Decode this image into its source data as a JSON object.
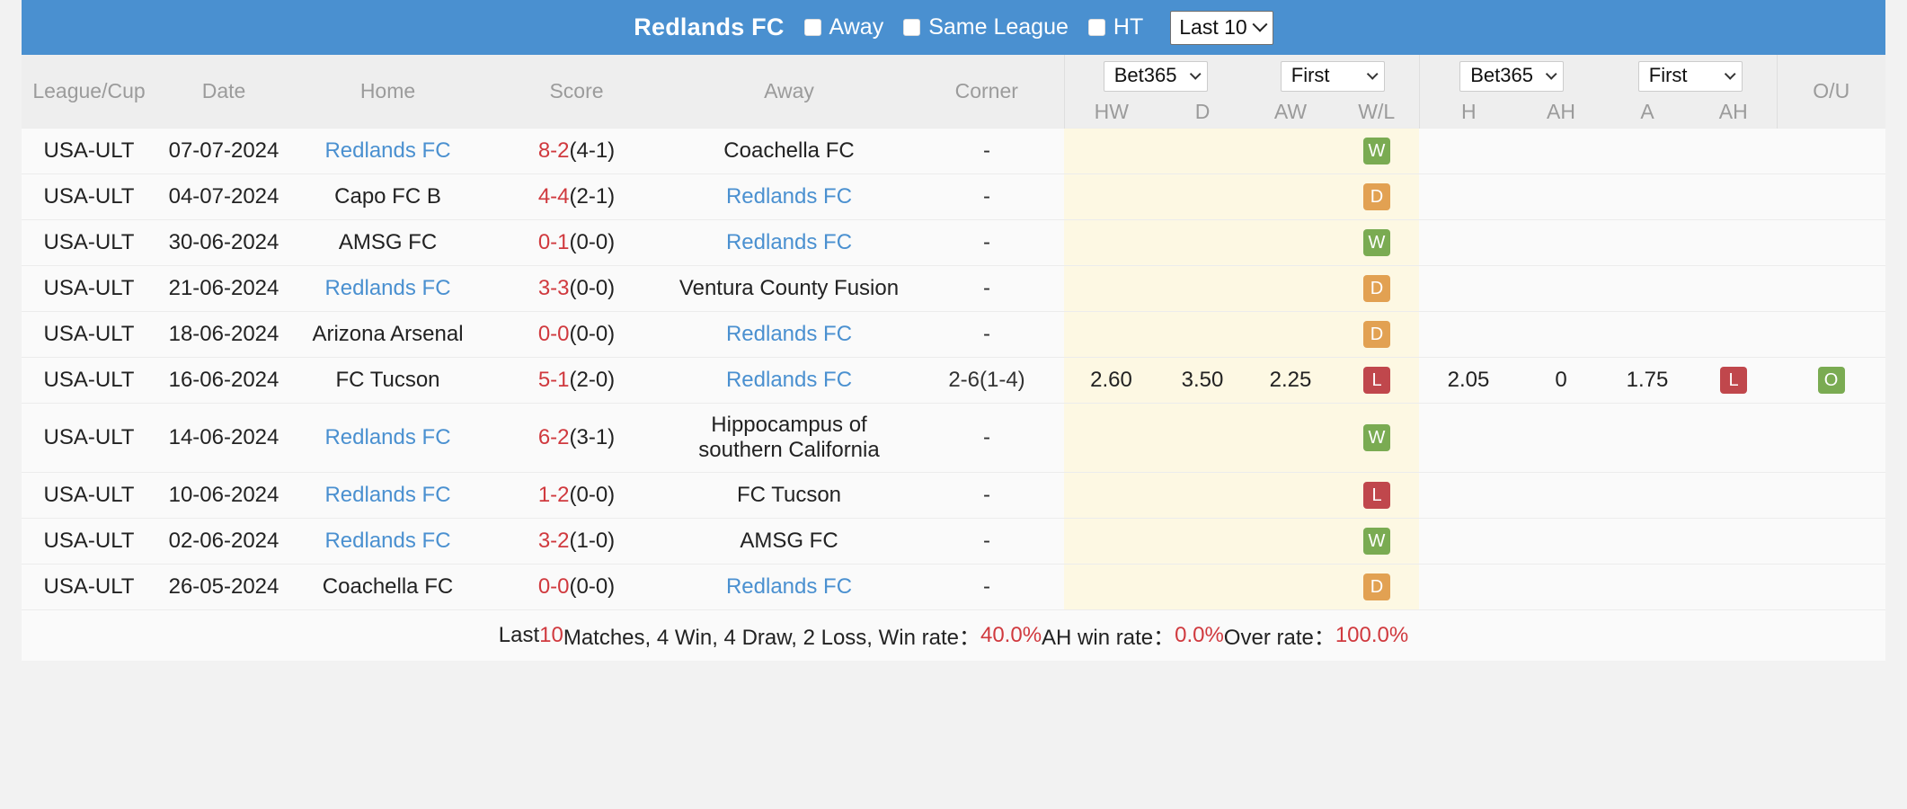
{
  "titlebar": {
    "team": "Redlands FC",
    "filters": [
      {
        "label": "Away",
        "checked": false
      },
      {
        "label": "Same League",
        "checked": false
      },
      {
        "label": "HT",
        "checked": false
      }
    ],
    "range_select": {
      "value": "Last 10",
      "icon": "chevron-down-icon"
    },
    "bg_color": "#4a90d0"
  },
  "table": {
    "headers": {
      "league": "League/Cup",
      "date": "Date",
      "home": "Home",
      "score": "Score",
      "away": "Away",
      "corner": "Corner",
      "ou": "O/U"
    },
    "group1": {
      "bookmaker": "Bet365",
      "period": "First",
      "subheaders": [
        "HW",
        "D",
        "AW",
        "W/L"
      ]
    },
    "group2": {
      "bookmaker": "Bet365",
      "period": "First",
      "subheaders": [
        "H",
        "AH",
        "A",
        "AH"
      ]
    },
    "rows": [
      {
        "league": "USA-ULT",
        "date": "07-07-2024",
        "home": "Redlands FC",
        "home_link": true,
        "score_main": "8-2",
        "score_ht": "(4-1)",
        "away": "Coachella FC",
        "away_link": false,
        "corner": "-",
        "hw": "",
        "d": "",
        "aw": "",
        "wl": "W",
        "wl_type": "w",
        "h": "",
        "ah1": "",
        "a": "",
        "ah2": "",
        "ah_res": "",
        "ah_res_type": "",
        "ou": "",
        "ou_type": ""
      },
      {
        "league": "USA-ULT",
        "date": "04-07-2024",
        "home": "Capo FC B",
        "home_link": false,
        "score_main": "4-4",
        "score_ht": "(2-1)",
        "away": "Redlands FC",
        "away_link": true,
        "corner": "-",
        "hw": "",
        "d": "",
        "aw": "",
        "wl": "D",
        "wl_type": "d",
        "h": "",
        "ah1": "",
        "a": "",
        "ah2": "",
        "ah_res": "",
        "ah_res_type": "",
        "ou": "",
        "ou_type": ""
      },
      {
        "league": "USA-ULT",
        "date": "30-06-2024",
        "home": "AMSG FC",
        "home_link": false,
        "score_main": "0-1",
        "score_ht": "(0-0)",
        "away": "Redlands FC",
        "away_link": true,
        "corner": "-",
        "hw": "",
        "d": "",
        "aw": "",
        "wl": "W",
        "wl_type": "w",
        "h": "",
        "ah1": "",
        "a": "",
        "ah2": "",
        "ah_res": "",
        "ah_res_type": "",
        "ou": "",
        "ou_type": ""
      },
      {
        "league": "USA-ULT",
        "date": "21-06-2024",
        "home": "Redlands FC",
        "home_link": true,
        "score_main": "3-3",
        "score_ht": "(0-0)",
        "away": "Ventura County Fusion",
        "away_link": false,
        "corner": "-",
        "hw": "",
        "d": "",
        "aw": "",
        "wl": "D",
        "wl_type": "d",
        "h": "",
        "ah1": "",
        "a": "",
        "ah2": "",
        "ah_res": "",
        "ah_res_type": "",
        "ou": "",
        "ou_type": ""
      },
      {
        "league": "USA-ULT",
        "date": "18-06-2024",
        "home": "Arizona Arsenal",
        "home_link": false,
        "score_main": "0-0",
        "score_ht": "(0-0)",
        "away": "Redlands FC",
        "away_link": true,
        "corner": "-",
        "hw": "",
        "d": "",
        "aw": "",
        "wl": "D",
        "wl_type": "d",
        "h": "",
        "ah1": "",
        "a": "",
        "ah2": "",
        "ah_res": "",
        "ah_res_type": "",
        "ou": "",
        "ou_type": ""
      },
      {
        "league": "USA-ULT",
        "date": "16-06-2024",
        "home": "FC Tucson",
        "home_link": false,
        "score_main": "5-1",
        "score_ht": "(2-0)",
        "away": "Redlands FC",
        "away_link": true,
        "corner": "2-6(1-4)",
        "hw": "2.60",
        "d": "3.50",
        "aw": "2.25",
        "wl": "L",
        "wl_type": "l",
        "h": "2.05",
        "ah1": "0",
        "a": "1.75",
        "ah2": "",
        "ah_res": "L",
        "ah_res_type": "l",
        "ou": "O",
        "ou_type": "o"
      },
      {
        "league": "USA-ULT",
        "date": "14-06-2024",
        "home": "Redlands FC",
        "home_link": true,
        "score_main": "6-2",
        "score_ht": "(3-1)",
        "away": "Hippocampus of southern California",
        "away_link": false,
        "corner": "-",
        "hw": "",
        "d": "",
        "aw": "",
        "wl": "W",
        "wl_type": "w",
        "h": "",
        "ah1": "",
        "a": "",
        "ah2": "",
        "ah_res": "",
        "ah_res_type": "",
        "ou": "",
        "ou_type": ""
      },
      {
        "league": "USA-ULT",
        "date": "10-06-2024",
        "home": "Redlands FC",
        "home_link": true,
        "score_main": "1-2",
        "score_ht": "(0-0)",
        "away": "FC Tucson",
        "away_link": false,
        "corner": "-",
        "hw": "",
        "d": "",
        "aw": "",
        "wl": "L",
        "wl_type": "l",
        "h": "",
        "ah1": "",
        "a": "",
        "ah2": "",
        "ah_res": "",
        "ah_res_type": "",
        "ou": "",
        "ou_type": ""
      },
      {
        "league": "USA-ULT",
        "date": "02-06-2024",
        "home": "Redlands FC",
        "home_link": true,
        "score_main": "3-2",
        "score_ht": "(1-0)",
        "away": "AMSG FC",
        "away_link": false,
        "corner": "-",
        "hw": "",
        "d": "",
        "aw": "",
        "wl": "W",
        "wl_type": "w",
        "h": "",
        "ah1": "",
        "a": "",
        "ah2": "",
        "ah_res": "",
        "ah_res_type": "",
        "ou": "",
        "ou_type": ""
      },
      {
        "league": "USA-ULT",
        "date": "26-05-2024",
        "home": "Coachella FC",
        "home_link": false,
        "score_main": "0-0",
        "score_ht": "(0-0)",
        "away": "Redlands FC",
        "away_link": true,
        "corner": "-",
        "hw": "",
        "d": "",
        "aw": "",
        "wl": "D",
        "wl_type": "d",
        "h": "",
        "ah1": "",
        "a": "",
        "ah2": "",
        "ah_res": "",
        "ah_res_type": "",
        "ou": "",
        "ou_type": ""
      }
    ]
  },
  "footer": {
    "p1": "Last ",
    "count": "10",
    "p2": " Matches, 4 Win, 4 Draw, 2 Loss, Win rate：",
    "win_rate": "40.0%",
    "p3": " AH win rate：",
    "ah_win_rate": "0.0%",
    "p4": " Over rate：",
    "over_rate": "100.0%"
  },
  "colors": {
    "accent": "#4a90d0",
    "link": "#4a90d0",
    "score": "#d0393e",
    "win": "#7aab52",
    "draw": "#e2a152",
    "loss": "#c0474c",
    "highlight": "#fdf8e3"
  }
}
